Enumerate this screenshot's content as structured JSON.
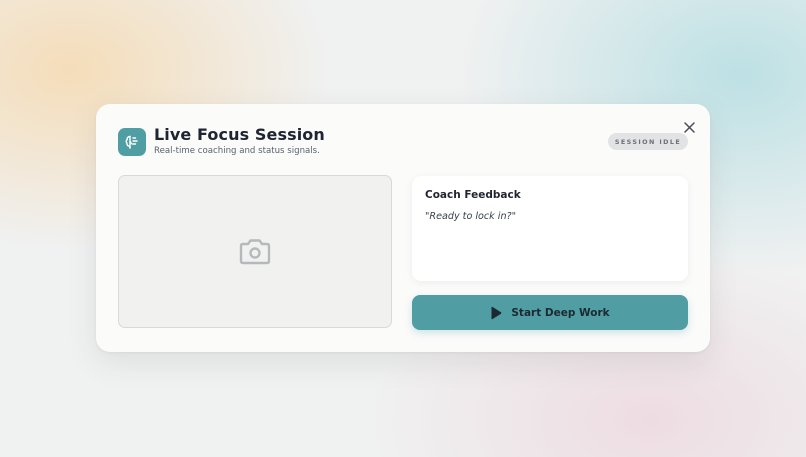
{
  "header": {
    "title": "Live Focus Session",
    "subtitle": "Real-time coaching and status signals.",
    "app_icon": "focus-brain-icon"
  },
  "status": {
    "label": "SESSION IDLE"
  },
  "camera": {
    "icon": "camera-icon"
  },
  "feedback": {
    "title": "Coach Feedback",
    "message": "\"Ready to lock in?\""
  },
  "actions": {
    "start_label": "Start Deep Work",
    "start_icon": "play-icon",
    "close_icon": "close-icon"
  },
  "colors": {
    "accent": "#509ea4",
    "badge_bg": "#e2e3e4",
    "title_text": "#1e2430"
  }
}
